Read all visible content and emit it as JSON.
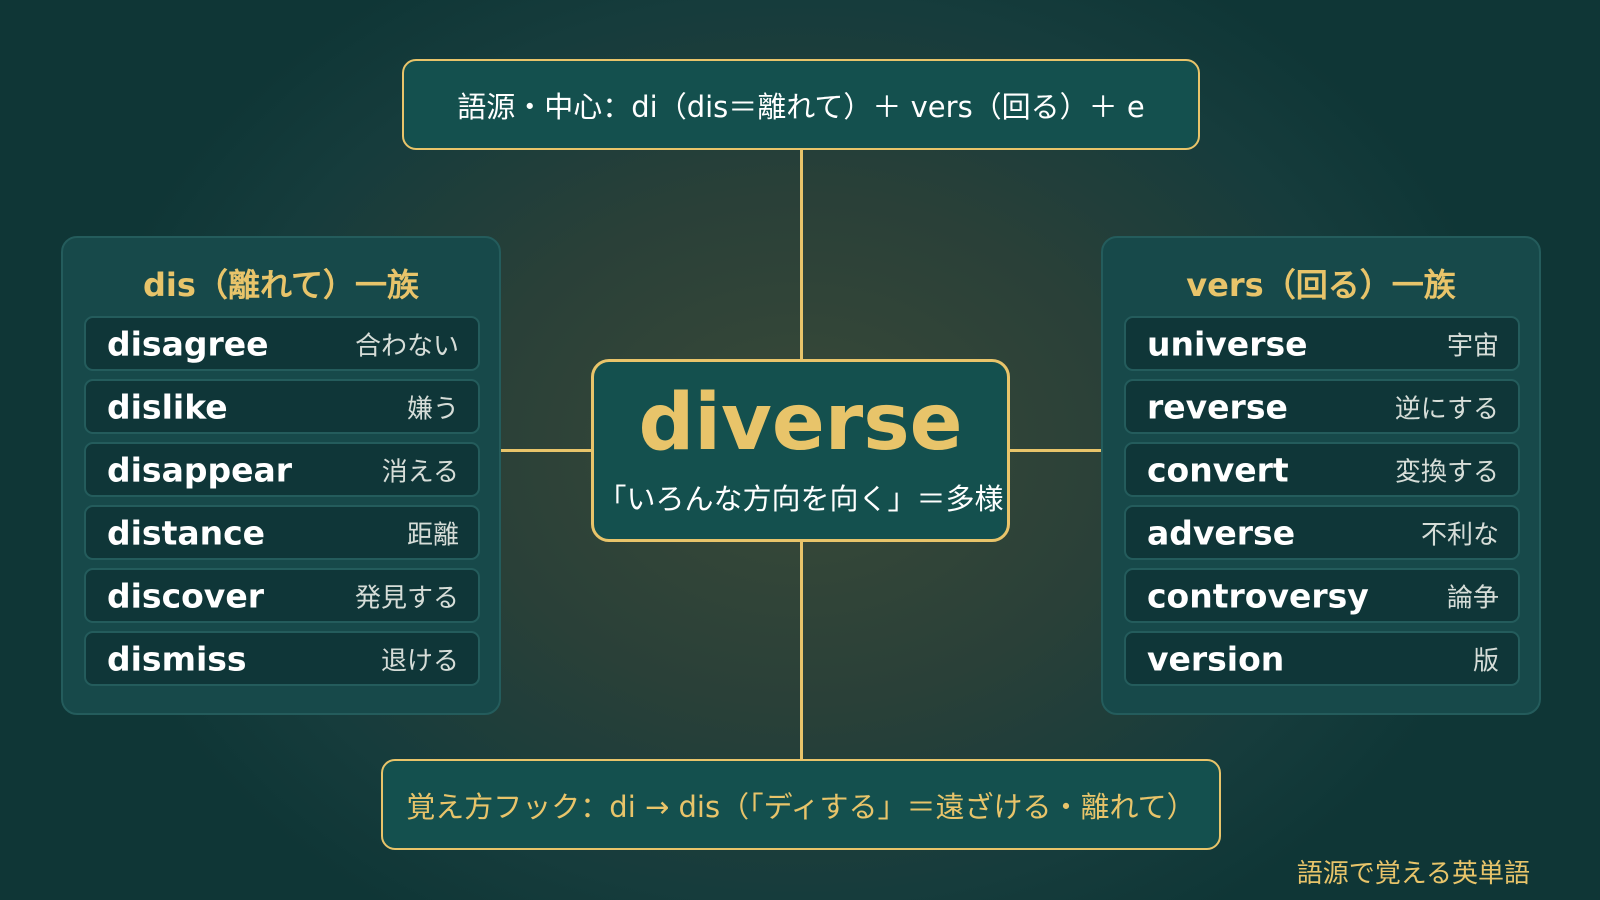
{
  "etymology": {
    "label": "語源・中心：di（dis＝離れて）＋ vers（回る）＋ e"
  },
  "center": {
    "word": "diverse",
    "meaning": "「いろんな方向を向く」＝多様"
  },
  "dis_family": {
    "title": "dis（離れて）一族",
    "items": [
      {
        "word": "disagree",
        "meaning": "合わない"
      },
      {
        "word": "dislike",
        "meaning": "嫌う"
      },
      {
        "word": "disappear",
        "meaning": "消える"
      },
      {
        "word": "distance",
        "meaning": "距離"
      },
      {
        "word": "discover",
        "meaning": "発見する"
      },
      {
        "word": "dismiss",
        "meaning": "退ける"
      }
    ]
  },
  "vers_family": {
    "title": "vers（回る）一族",
    "items": [
      {
        "word": "universe",
        "meaning": "宇宙"
      },
      {
        "word": "reverse",
        "meaning": "逆にする"
      },
      {
        "word": "convert",
        "meaning": "変換する"
      },
      {
        "word": "adverse",
        "meaning": "不利な"
      },
      {
        "word": "controversy",
        "meaning": "論争"
      },
      {
        "word": "version",
        "meaning": "版"
      }
    ]
  },
  "hook": {
    "label": "覚え方フック：di → dis（「ディする」＝遠ざける・離れて）"
  },
  "brand": {
    "label": "語源で覚える英単語"
  },
  "colors": {
    "accent": "#e8c46a",
    "box_fill": "#14504e",
    "panel_fill": "#17494a",
    "row_fill": "#0f3638"
  }
}
